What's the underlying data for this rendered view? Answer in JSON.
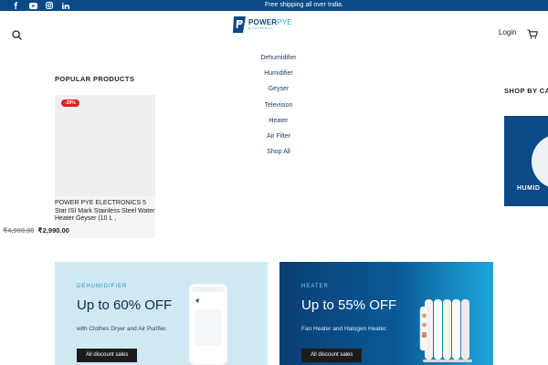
{
  "topbar": {
    "announcement": "Free shipping all over India.",
    "social": [
      "facebook-icon",
      "youtube-icon",
      "instagram-icon",
      "linkedin-icon"
    ],
    "bg_color": "#0b4a86"
  },
  "header": {
    "logo": {
      "word1": "POWER",
      "word2": "PYE",
      "sub": "ELECTRONICS"
    },
    "login_label": "Login",
    "icons": [
      "search-icon",
      "cart-icon"
    ]
  },
  "menu": {
    "items": [
      "Dehumidifier",
      "Humidifier",
      "Geyser",
      "Television",
      "Heater",
      "Air Filter",
      "Shop All"
    ]
  },
  "popular": {
    "title": "POPULAR PRODUCTS",
    "product": {
      "badge": "-39%",
      "title": "POWER PYE ELECTRONICS 5 Star ISI Mark Stainless Steel Water Heater Geyser (10 L ,",
      "old_price": "₹4,900.00",
      "new_price": "₹2,990.00"
    }
  },
  "shop_by_category": {
    "title": "SHOP BY CA",
    "card_label": "HUMID"
  },
  "banners": [
    {
      "category": "DEHUMIDIFIER",
      "headline": "Up to 60% OFF",
      "sub": "with Clothes Dryer and Air Purifier.",
      "button": "All discount sales",
      "bg_color": "#cfe9f3"
    },
    {
      "category": "HEATER",
      "headline": "Up to 55% OFF",
      "sub": "Fan Heater and Halogen Heater.",
      "button": "All discount sales",
      "bg_color": "#0a4a86"
    }
  ]
}
